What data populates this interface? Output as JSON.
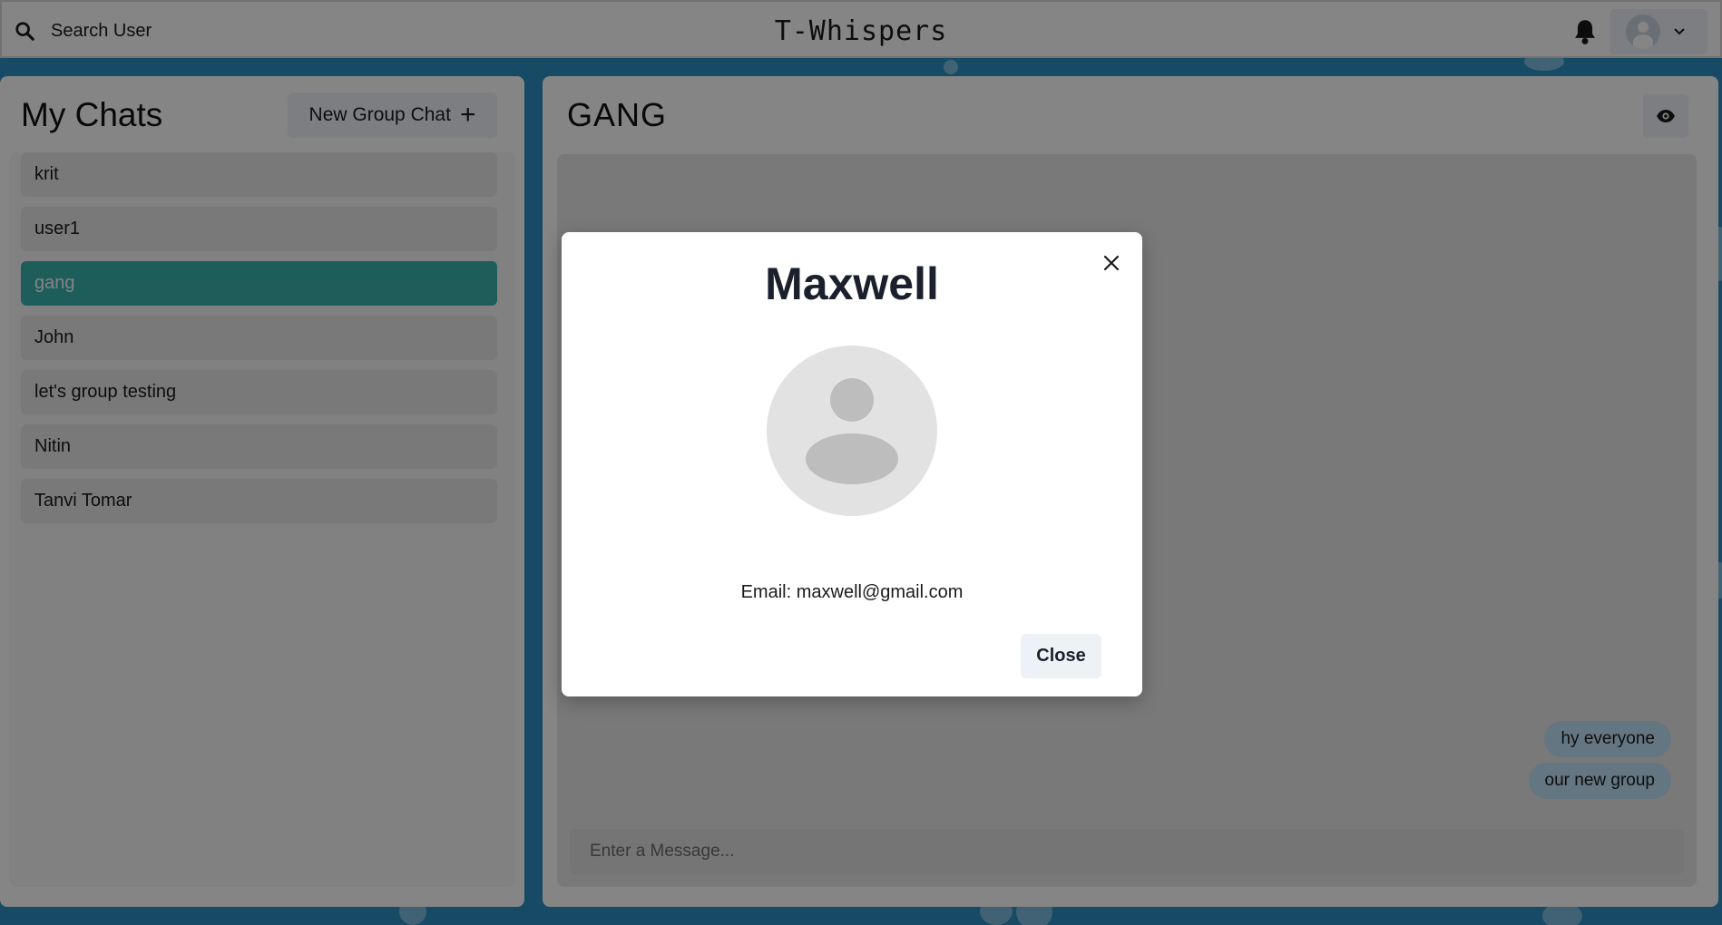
{
  "header": {
    "search_label": "Search User",
    "app_title": "T-Whispers"
  },
  "sidebar": {
    "title": "My Chats",
    "new_group_label": "New Group Chat",
    "new_group_icon": "+",
    "chats": [
      {
        "name": "krit",
        "active": false
      },
      {
        "name": "user1",
        "active": false
      },
      {
        "name": "gang",
        "active": true
      },
      {
        "name": "John",
        "active": false
      },
      {
        "name": "let's group testing",
        "active": false
      },
      {
        "name": "Nitin",
        "active": false
      },
      {
        "name": "Tanvi Tomar",
        "active": false
      }
    ]
  },
  "chat": {
    "title": "GANG",
    "messages": [
      {
        "text": "hy everyone"
      },
      {
        "text": "our new group"
      }
    ],
    "input_placeholder": "Enter a Message..."
  },
  "modal": {
    "name": "Maxwell",
    "email_text": "Email: maxwell@gmail.com",
    "close_label": "Close"
  },
  "colors": {
    "active_chat": "#38b2ac",
    "bubble": "#bee3f8",
    "button_bg": "#edf2f7",
    "background": "#2b8fc2"
  }
}
